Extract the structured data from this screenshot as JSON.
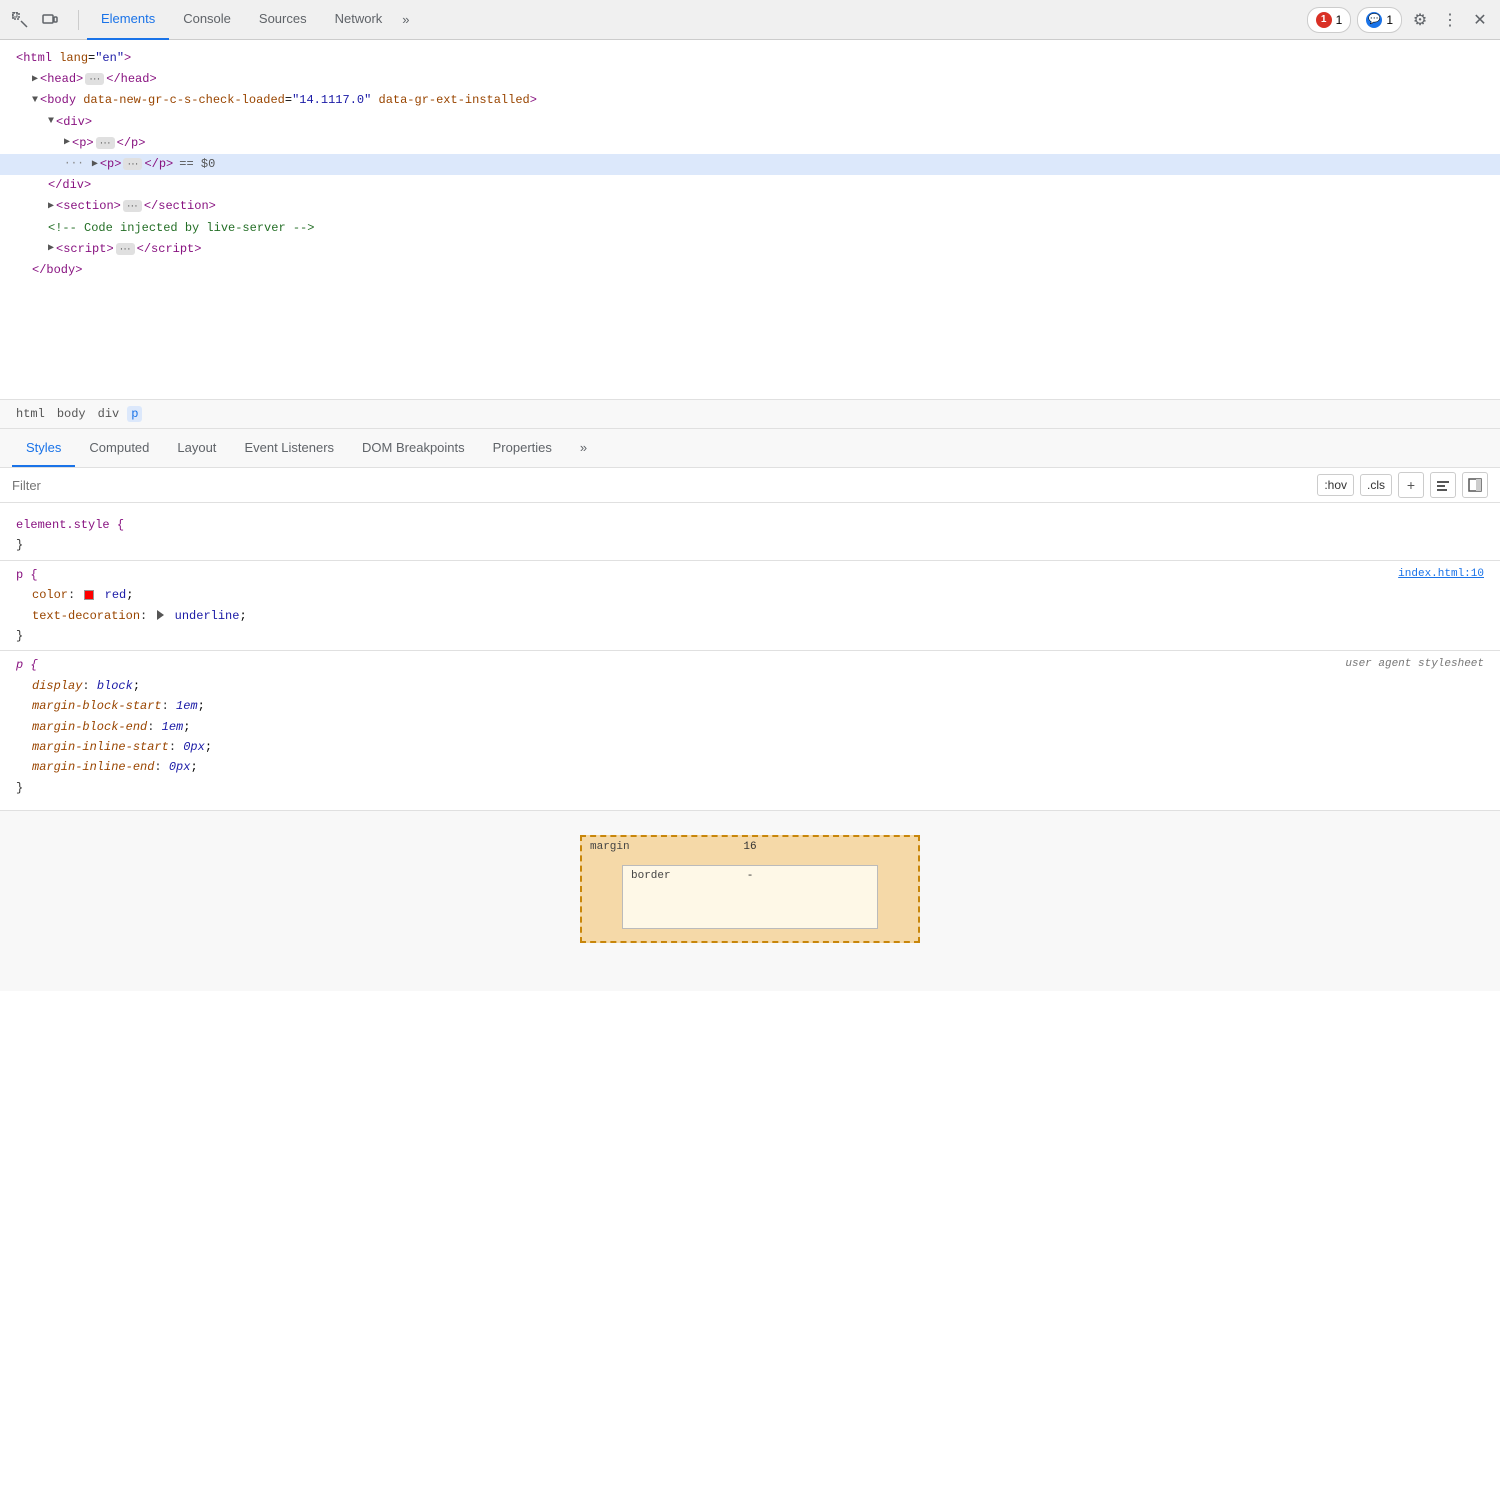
{
  "toolbar": {
    "tabs": [
      {
        "id": "elements",
        "label": "Elements",
        "active": true
      },
      {
        "id": "console",
        "label": "Console",
        "active": false
      },
      {
        "id": "sources",
        "label": "Sources",
        "active": false
      },
      {
        "id": "network",
        "label": "Network",
        "active": false
      }
    ],
    "chevron": "»",
    "error_badge": "1",
    "warn_badge": "1",
    "settings_icon": "⚙",
    "more_icon": "⋮",
    "close_icon": "✕"
  },
  "dom_tree": {
    "lines": [
      {
        "id": 1,
        "indent": 1,
        "html": "<span class='tag-purple'>&lt;html</span> <span class='attr-name'>lang</span>=<span class='attr-value'>\"en\"</span><span class='tag-purple'>&gt;</span>",
        "selected": false
      },
      {
        "id": 2,
        "indent": 2,
        "html": "<span class='expand-arrow'>▶</span> <span class='tag-purple'>&lt;head&gt;</span><button class='dots-btn'>···</button><span class='tag-purple'>&lt;/head&gt;</span>",
        "selected": false
      },
      {
        "id": 3,
        "indent": 2,
        "html": "<span class='expand-arrow'>▼</span> <span class='tag-purple'>&lt;body</span> <span class='attr-name'>data-new-gr-c-s-check-loaded</span>=<span class='attr-value'>\"14.1117.0\"</span> <span class='attr-name'>data-gr-ext-installed</span><span class='tag-purple'>&gt;</span>",
        "selected": false
      },
      {
        "id": 4,
        "indent": 3,
        "html": "<span class='expand-arrow'>▼</span> <span class='tag-purple'>&lt;div&gt;</span>",
        "selected": false
      },
      {
        "id": 5,
        "indent": 4,
        "html": "<span class='expand-arrow'>▶</span> <span class='tag-purple'>&lt;p&gt;</span><button class='dots-btn'>···</button><span class='tag-purple'>&lt;/p&gt;</span>",
        "selected": false
      },
      {
        "id": 6,
        "indent": 4,
        "html": "<span class='expand-arrow'>▶</span> <span class='tag-purple'>&lt;p&gt;</span><button class='dots-btn'>···</button><span class='tag-purple'>&lt;/p&gt;</span> <span style='color:#555'>==</span> <span style='color:#555'>$0</span>",
        "selected": true,
        "dots_prefix": "···"
      },
      {
        "id": 7,
        "indent": 3,
        "html": "<span class='tag-purple'>&lt;/div&gt;</span>",
        "selected": false
      },
      {
        "id": 8,
        "indent": 3,
        "html": "<span class='expand-arrow'>▶</span> <span class='tag-purple'>&lt;section&gt;</span><button class='dots-btn'>···</button><span class='tag-purple'>&lt;/section&gt;</span>",
        "selected": false
      },
      {
        "id": 9,
        "indent": 3,
        "html": "<span class='comment-color'>&lt;!-- Code injected by live-server --&gt;</span>",
        "selected": false
      },
      {
        "id": 10,
        "indent": 3,
        "html": "<span class='expand-arrow'>▶</span> <span class='tag-purple'>&lt;script&gt;</span><button class='dots-btn'>···</button><span class='tag-purple'>&lt;/script&gt;</span>",
        "selected": false
      },
      {
        "id": 11,
        "indent": 2,
        "html": "<span class='tag-purple'>&lt;/body&gt;</span>",
        "selected": false
      }
    ]
  },
  "breadcrumbs": [
    {
      "label": "html",
      "active": false
    },
    {
      "label": "body",
      "active": false
    },
    {
      "label": "div",
      "active": false
    },
    {
      "label": "p",
      "active": true
    }
  ],
  "styles_panel": {
    "tabs": [
      {
        "id": "styles",
        "label": "Styles",
        "active": true
      },
      {
        "id": "computed",
        "label": "Computed",
        "active": false
      },
      {
        "id": "layout",
        "label": "Layout",
        "active": false
      },
      {
        "id": "event-listeners",
        "label": "Event Listeners",
        "active": false
      },
      {
        "id": "dom-breakpoints",
        "label": "DOM Breakpoints",
        "active": false
      },
      {
        "id": "properties",
        "label": "Properties",
        "active": false
      },
      {
        "id": "more",
        "label": "»",
        "active": false
      }
    ],
    "filter": {
      "placeholder": "Filter",
      "hov_label": ":hov",
      "cls_label": ".cls",
      "add_label": "+",
      "new_rule_icon": "new rule",
      "toggle_icon": "toggle"
    },
    "css_blocks": [
      {
        "selector": "element.style {",
        "close": "}",
        "source": "",
        "props": []
      },
      {
        "selector": "p {",
        "close": "}",
        "source": "index.html:10",
        "props": [
          {
            "name": "color",
            "colon": ":",
            "value": "red",
            "has_swatch": true,
            "swatch_color": "#ff0000"
          },
          {
            "name": "text-decoration",
            "colon": ":",
            "value": "underline",
            "has_triangle": true
          }
        ]
      },
      {
        "selector": "p {",
        "close": "}",
        "source": "user agent stylesheet",
        "source_italic": true,
        "props": [
          {
            "name": "display",
            "colon": ":",
            "value": "block"
          },
          {
            "name": "margin-block-start",
            "colon": ":",
            "value": "1em"
          },
          {
            "name": "margin-block-end",
            "colon": ":",
            "value": "1em"
          },
          {
            "name": "margin-inline-start",
            "colon": ":",
            "value": "0px"
          },
          {
            "name": "margin-inline-end",
            "colon": ":",
            "value": "0px"
          }
        ]
      }
    ]
  },
  "box_model": {
    "outer_label": "margin",
    "outer_value": "16",
    "inner_label": "border",
    "inner_value": "-"
  }
}
